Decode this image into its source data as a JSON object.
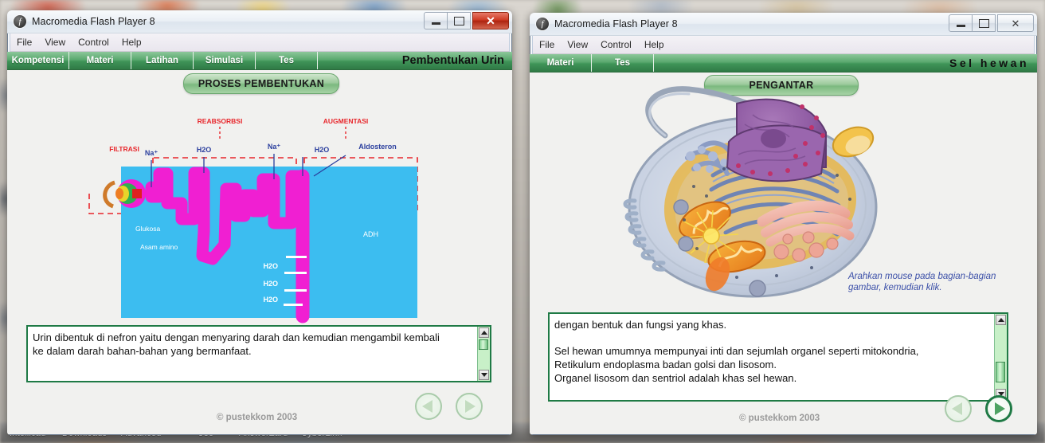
{
  "desktop": {
    "taskbar_items": [
      "Intellicad",
      "Downloads",
      "Advanced",
      "Use",
      "AnswerZard",
      "CyberLink"
    ]
  },
  "windows": [
    {
      "id": "left",
      "title": "Macromedia Flash Player 8",
      "icon": "flash-icon",
      "active": true,
      "controls": {
        "minimize": "minimize-icon",
        "maximize": "maximize-icon",
        "close": "close-icon",
        "close_label": "✕"
      },
      "menu": [
        "File",
        "View",
        "Control",
        "Help"
      ],
      "nav": {
        "tabs": [
          "Kompetensi",
          "Materi",
          "Latihan",
          "Simulasi",
          "Tes"
        ],
        "title": "Pembentukan Urin"
      },
      "pill_label": "PROSES PEMBENTUKAN",
      "diagram": {
        "process_labels": [
          "FILTRASI",
          "REABSORBSI",
          "AUGMENTASI"
        ],
        "substance_labels": [
          "Na⁺",
          "H2O",
          "Na⁺",
          "H2O",
          "Aldosteron"
        ],
        "inner_labels": [
          "Glukosa",
          "Asam amino",
          "ADH"
        ],
        "water_labels": [
          "H2O",
          "H2O",
          "H2O"
        ],
        "colors": {
          "background": "#3cbdf0",
          "tubule": "#f01fd2",
          "process_text": "#e8262b",
          "substance_text": "#2b3f9e",
          "inner_text": "#ffffff"
        }
      },
      "textbox": {
        "lines": [
          "Urin dibentuk di nefron yaitu dengan menyaring darah dan kemudian mengambil kembali",
          "ke dalam darah bahan-bahan yang bermanfaat."
        ]
      },
      "footer": {
        "copyright": "© pustekkom 2003",
        "prev_icon": "prev-triangle-icon",
        "next_icon": "next-triangle-icon",
        "next_active": false
      }
    },
    {
      "id": "right",
      "title": "Macromedia Flash Player 8",
      "icon": "flash-icon",
      "active": false,
      "controls": {
        "minimize": "minimize-icon",
        "maximize": "maximize-icon",
        "close": "close-icon",
        "close_label": "✕"
      },
      "menu": [
        "File",
        "View",
        "Control",
        "Help"
      ],
      "nav": {
        "tabs": [
          "Materi",
          "Tes"
        ],
        "title": "Sel hewan"
      },
      "pill_label": "PENGANTAR",
      "hint": {
        "line1": "Arahkan mouse pada bagian-bagian",
        "line2": "gambar, kemudian klik."
      },
      "illustration": "animal-cell-diagram",
      "textbox": {
        "line1": "dengan bentuk dan fungsi yang khas.",
        "line2": "Sel hewan umumnya mempunyai inti dan sejumlah organel seperti mitokondria,",
        "line3": "Retikulum endoplasma badan golsi dan lisosom.",
        "line4": "Organel lisosom dan sentriol adalah khas sel hewan."
      },
      "footer": {
        "copyright": "© pustekkom 2003",
        "prev_icon": "prev-triangle-icon",
        "next_icon": "next-triangle-icon",
        "next_active": true
      }
    }
  ]
}
